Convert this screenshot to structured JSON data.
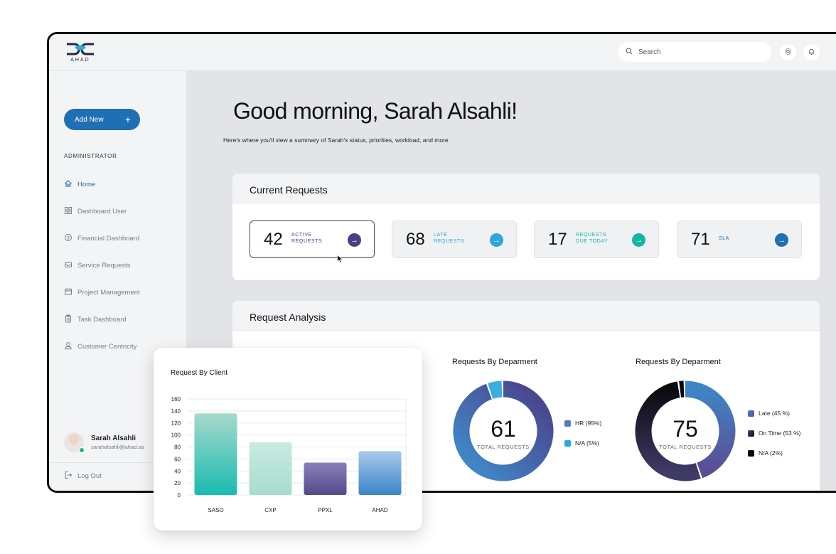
{
  "header": {
    "logo_text": "AHAD",
    "search_placeholder": "Search",
    "settings_icon": "gear-icon",
    "notifications_icon": "bell-icon"
  },
  "sidebar": {
    "add_new_label": "Add New",
    "add_new_icon": "+",
    "role_label": "ADMINISTRATOR",
    "items": [
      {
        "label": "Home",
        "icon": "home-icon",
        "active": true
      },
      {
        "label": "Dashboard User",
        "icon": "grid-icon",
        "active": false
      },
      {
        "label": "Financial Dashboard",
        "icon": "dollar-icon",
        "active": false
      },
      {
        "label": "Service Requests",
        "icon": "inbox-icon",
        "active": false
      },
      {
        "label": "Project Management",
        "icon": "calendar-icon",
        "active": false
      },
      {
        "label": "Task Dashboard",
        "icon": "clipboard-icon",
        "active": false
      },
      {
        "label": "Customer Centricity",
        "icon": "person-icon",
        "active": false
      }
    ],
    "user": {
      "name": "Sarah Alsahli",
      "email": "sarahalsahli@ahad.sa"
    },
    "logout_label": "Log Out"
  },
  "main": {
    "greeting": "Good morning, Sarah Alsahli!",
    "subtitle": "Here's where you'll view a summary of Sarah's status, priorities, workload, and more",
    "current_requests": {
      "title": "Current Requests",
      "cards": [
        {
          "value": "42",
          "label_line1": "ACTIVE",
          "label_line2": "REQUESTS",
          "label_color": "#4b3f86",
          "arrow_color": "#4b3f86",
          "selected": true
        },
        {
          "value": "68",
          "label_line1": "LATE",
          "label_line2": "REQUESTS",
          "label_color": "#2aa8de",
          "arrow_color": "#2aa8de",
          "selected": false
        },
        {
          "value": "17",
          "label_line1": "REQUESTS",
          "label_line2": "DUE TODAY",
          "label_color": "#13b5a6",
          "arrow_color": "#13b5a6",
          "selected": false
        },
        {
          "value": "71",
          "label_line1": "SLA",
          "label_line2": "",
          "label_color": "#1f6fb5",
          "arrow_color": "#1f6fb5",
          "selected": false
        }
      ]
    },
    "request_analysis": {
      "title": "Request Analysis",
      "donuts": [
        {
          "title": "Requests By Deparment",
          "total": "61",
          "total_label": "TOTAL REQUESTS",
          "segments": [
            {
              "label": "HR (95%)",
              "value": 95,
              "color": "#5a4e93"
            },
            {
              "label": "N/A (5%)",
              "value": 5,
              "color": "#2aa8de"
            }
          ]
        },
        {
          "title": "Requests By Deparment",
          "total": "75",
          "total_label": "TOTAL REQUESTS",
          "segments": [
            {
              "label": "Late (45 %)",
              "value": 45,
              "color": "#5a4e93"
            },
            {
              "label": "On Time (53 %)",
              "value": 53,
              "color": "#1a1a24"
            },
            {
              "label": "N/A (2%)",
              "value": 2,
              "color": "#0a0a0a"
            }
          ]
        }
      ]
    }
  },
  "client_chart": {
    "title": "Request By Client",
    "chart_data": {
      "type": "bar",
      "categories": [
        "SASO",
        "CXP",
        "PPXL",
        "AHAD"
      ],
      "values": [
        136,
        88,
        54,
        73
      ],
      "ylim": [
        0,
        160
      ],
      "yticks": [
        0,
        20,
        40,
        60,
        80,
        100,
        120,
        140,
        160
      ],
      "grid": true,
      "colors": [
        [
          "#a8d8cc",
          "#18bcb0"
        ],
        [
          "#c9ebe1",
          "#a8dccd"
        ],
        [
          "#8a80b8",
          "#544a8c"
        ],
        [
          "#a9c9ec",
          "#3a85c7"
        ]
      ]
    }
  }
}
